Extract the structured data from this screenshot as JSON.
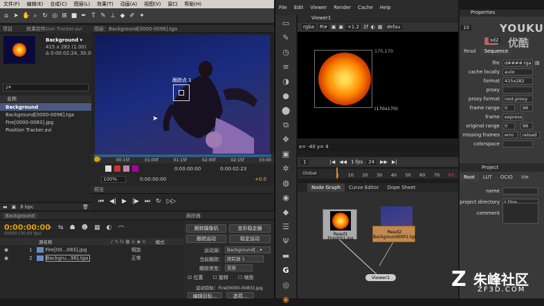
{
  "ae": {
    "menu": [
      "文件(F)",
      "编辑(E)",
      "合成(C)",
      "图层(L)",
      "效果(T)",
      "动画(A)",
      "视图(V)",
      "窗口",
      "帮助(H)"
    ],
    "project_tab": "项目",
    "effects_tab": "效果控件：Ba",
    "effects_tab2": "tion Tracker.avi",
    "footage_tab": "图层：Background[0000-0096].tga",
    "selected_name": "Background ▾",
    "selected_info1": "415 x 282 (1.00)",
    "selected_info2": "Δ 0:00:02:24, 30.00",
    "search_placeholder": "ρ▾",
    "col_name": "名称",
    "items": [
      "Background",
      "Background[0000-0096].tga",
      "Fire[0000-0083].jpg",
      "Position Tracker.avi"
    ],
    "bpc": "8 bpc",
    "track_label": "跟踪点 1",
    "time_marks": [
      "00f",
      "00:15f",
      "01:00f",
      "01:15f",
      "02:00f",
      "02:15f",
      "03:00"
    ],
    "zoom": "100%",
    "time_a": "0:00:00:00",
    "time_b": "0:00:02:23",
    "time_c": "0:00:00:00",
    "exposure": "+0.0",
    "preview_tab": "预览",
    "timeline_tab": "Background",
    "timecode": "0:00:00:00",
    "timecode_sub": "00000 (30.00 fps)",
    "layer_col": "源名称",
    "parent_col": "模式",
    "layers": [
      {
        "num": "1",
        "name": "Fire[00...083].jpg",
        "mode": "相加"
      },
      {
        "num": "2",
        "name": "Backgru...96].tga",
        "mode": "正常"
      }
    ],
    "tracker_tab": "跟踪器",
    "tracker_btn1": "跟踪摄像机",
    "tracker_btn2": "变形稳定器",
    "tracker_btn3": "跟踪运动",
    "tracker_btn4": "稳定运动",
    "motion_source_label": "运动源：",
    "motion_source": "Background[...▾",
    "current_track_label": "当前跟踪：",
    "current_track": "跟踪器 1",
    "track_type_label": "跟踪类型：",
    "track_type": "变换",
    "chk_position": "位置",
    "chk_rotation": "旋转",
    "chk_scale": "缩放",
    "motion_target": "运动目标：Fire[0000-0083].jpg",
    "bottom_btn1": "编辑目标...",
    "bottom_btn2": "选项..."
  },
  "nuke": {
    "menu": [
      "File",
      "Edit",
      "Viewer",
      "Render",
      "Cache",
      "Help"
    ],
    "viewer_tab": "Viewer1",
    "channel": "rgba",
    "channel2": "R\\▾",
    "gain": "+1.2",
    "gain_exp": "2f",
    "defaults": "defau",
    "size_label_top": "170,170",
    "size_label_bottom": "(170x170)",
    "coords": "x= -40 y= 4",
    "frame": "1",
    "fps_label": "1 fps",
    "fps": "24",
    "global": "Global",
    "ruler": [
      "1",
      "10",
      "20",
      "30",
      "40",
      "50",
      "60",
      "70",
      "83"
    ],
    "frame_end": "83",
    "tabs": [
      "Node Graph",
      "Curve Editor",
      "Dope Sheet"
    ],
    "node_read1": "Read1",
    "node_read1_file": "Fire0001.jpg",
    "node_read2": "Read2",
    "node_read2_file": "Background0001.tga",
    "node_viewer": "Viewer1",
    "props_title": "Properties",
    "props_count": "10",
    "node_name": "sd2",
    "props_tabs": [
      "Read",
      "Sequence"
    ],
    "rows": [
      {
        "label": "file",
        "value": "d####.tga"
      },
      {
        "label": "cache locally",
        "value": "auto"
      },
      {
        "label": "format",
        "value": "415x282"
      },
      {
        "label": "proxy",
        "value": ""
      },
      {
        "label": "proxy format",
        "value": "root.proxy"
      },
      {
        "label": "frame range",
        "value": "0",
        "value2": "96"
      },
      {
        "label": "frame",
        "value": "express"
      },
      {
        "label": "original range",
        "value": "0",
        "value2": "96"
      },
      {
        "label": "missing frames",
        "value": "erro",
        "value2": "reload"
      },
      {
        "label": "colorspace",
        "value": ""
      }
    ],
    "project_title": "Project",
    "project_tabs": [
      "Root",
      "LUT",
      "OCIO",
      "Vie"
    ],
    "project_rows": [
      {
        "label": "name",
        "value": ""
      },
      {
        "label": "project directory",
        "value": "t Dire"
      },
      {
        "label": "comment",
        "value": ""
      }
    ]
  },
  "watermark_top": "YOUKU",
  "watermark_top2": "优酷",
  "watermark_bottom": "朱峰社区",
  "watermark_bottom2": "ZF3D.COM"
}
